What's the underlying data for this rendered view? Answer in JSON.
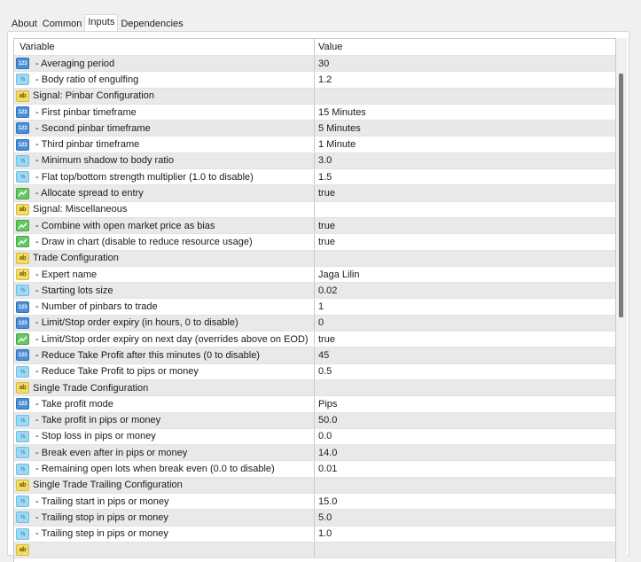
{
  "tabs": [
    {
      "label": "About",
      "active": false
    },
    {
      "label": "Common",
      "active": false
    },
    {
      "label": "Inputs",
      "active": true
    },
    {
      "label": "Dependencies",
      "active": false
    }
  ],
  "table": {
    "columns": {
      "variable": "Variable",
      "value": "Value"
    },
    "icon_types": {
      "int": {
        "name": "integer-icon",
        "glyph": "123"
      },
      "dbl": {
        "name": "double-icon",
        "glyph": "½"
      },
      "str": {
        "name": "string-icon",
        "glyph": "ab"
      },
      "bool": {
        "name": "boolean-icon",
        "glyph": "chart-line"
      }
    },
    "rows": [
      {
        "type": "int",
        "variable": " - Averaging period",
        "value": "30"
      },
      {
        "type": "dbl",
        "variable": " - Body ratio of engulfing",
        "value": "1.2"
      },
      {
        "type": "str",
        "variable": "Signal: Pinbar Configuration",
        "value": ""
      },
      {
        "type": "int",
        "variable": " - First pinbar timeframe",
        "value": "15 Minutes"
      },
      {
        "type": "int",
        "variable": " - Second pinbar timeframe",
        "value": "5 Minutes"
      },
      {
        "type": "int",
        "variable": " - Third pinbar timeframe",
        "value": "1 Minute"
      },
      {
        "type": "dbl",
        "variable": " - Minimum shadow to body ratio",
        "value": "3.0"
      },
      {
        "type": "dbl",
        "variable": " - Flat top/bottom strength multiplier (1.0 to disable)",
        "value": "1.5"
      },
      {
        "type": "bool",
        "variable": " - Allocate spread to entry",
        "value": "true"
      },
      {
        "type": "str",
        "variable": "Signal: Miscellaneous",
        "value": ""
      },
      {
        "type": "bool",
        "variable": " - Combine with open market price as bias",
        "value": "true"
      },
      {
        "type": "bool",
        "variable": " - Draw in chart (disable to reduce resource usage)",
        "value": "true"
      },
      {
        "type": "str",
        "variable": "Trade Configuration",
        "value": ""
      },
      {
        "type": "str",
        "variable": " - Expert name",
        "value": "Jaga Lilin"
      },
      {
        "type": "dbl",
        "variable": " - Starting lots size",
        "value": "0.02"
      },
      {
        "type": "int",
        "variable": " - Number of pinbars to trade",
        "value": "1"
      },
      {
        "type": "int",
        "variable": " - Limit/Stop order expiry (in hours, 0 to disable)",
        "value": "0"
      },
      {
        "type": "bool",
        "variable": " - Limit/Stop order expiry on next day (overrides above on EOD)",
        "value": "true"
      },
      {
        "type": "int",
        "variable": " - Reduce Take Profit after this minutes (0 to disable)",
        "value": "45"
      },
      {
        "type": "dbl",
        "variable": " - Reduce Take Profit to pips or money",
        "value": "0.5"
      },
      {
        "type": "str",
        "variable": "Single Trade Configuration",
        "value": ""
      },
      {
        "type": "int",
        "variable": " - Take profit mode",
        "value": "Pips"
      },
      {
        "type": "dbl",
        "variable": " - Take profit in pips or money",
        "value": "50.0"
      },
      {
        "type": "dbl",
        "variable": " - Stop loss in pips or money",
        "value": "0.0"
      },
      {
        "type": "dbl",
        "variable": " - Break even after in pips or money",
        "value": "14.0"
      },
      {
        "type": "dbl",
        "variable": " - Remaining open lots when break even (0.0 to disable)",
        "value": "0.01"
      },
      {
        "type": "str",
        "variable": "Single Trade Trailing Configuration",
        "value": ""
      },
      {
        "type": "dbl",
        "variable": " - Trailing start in pips or money",
        "value": "15.0"
      },
      {
        "type": "dbl",
        "variable": " - Trailing stop in pips or money",
        "value": "5.0"
      },
      {
        "type": "dbl",
        "variable": " - Trailing step in pips or money",
        "value": "1.0"
      },
      {
        "type": "str",
        "variable": "",
        "value": ""
      }
    ]
  },
  "scrollbar": {
    "position_fraction": 0.0,
    "visible_fraction": 0.47
  },
  "colors": {
    "row_alt": "#e9e9e9",
    "int_icon": "#4a8fd8",
    "double_icon": "#9fd8f2",
    "string_icon": "#f2dc68",
    "bool_icon": "#66c866"
  }
}
